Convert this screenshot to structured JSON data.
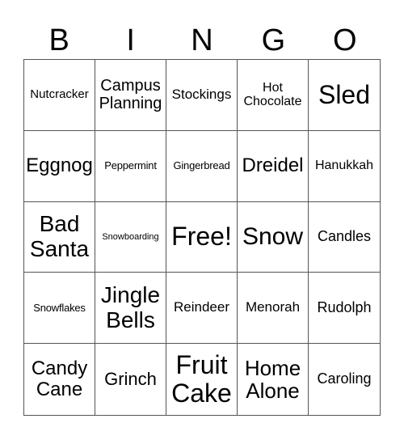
{
  "header": [
    "B",
    "I",
    "N",
    "G",
    "O"
  ],
  "cells": [
    "Nutcracker",
    "Campus Planning",
    "Stockings",
    "Hot Chocolate",
    "Sled",
    "Eggnog",
    "Peppermint",
    "Gingerbread",
    "Dreidel",
    "Hanukkah",
    "Bad Santa",
    "Snowboarding",
    "Free!",
    "Snow",
    "Candles",
    "Snowflakes",
    "Jingle Bells",
    "Reindeer",
    "Menorah",
    "Rudolph",
    "Candy Cane",
    "Grinch",
    "Fruit Cake",
    "Home Alone",
    "Caroling"
  ]
}
